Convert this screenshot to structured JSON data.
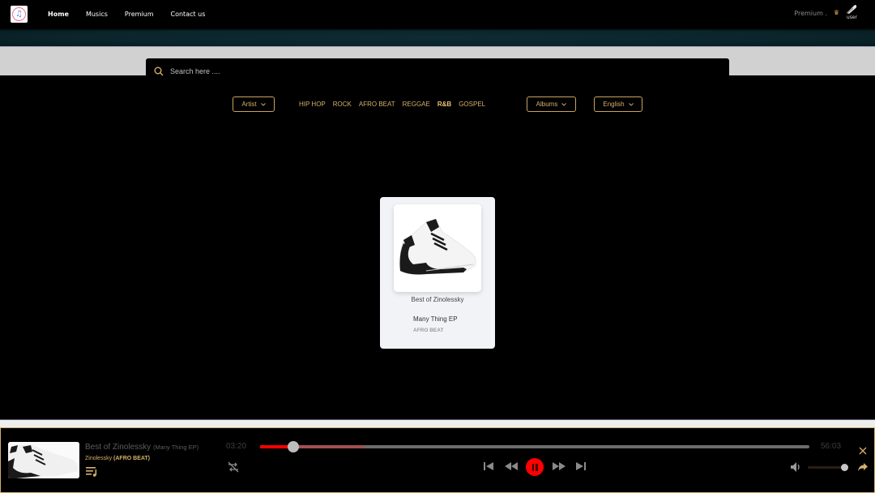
{
  "nav": {
    "logo": "music-app-logo",
    "links": [
      {
        "label": "Home",
        "active": true
      },
      {
        "label": "Musics",
        "active": false
      },
      {
        "label": "Premium",
        "active": false
      },
      {
        "label": "Contact us",
        "active": false
      }
    ],
    "premium_label": "Premium",
    "premium_separator": ".",
    "crown_icon": "crown-icon",
    "user_label": "user"
  },
  "search": {
    "placeholder": "Search here ....",
    "value": ""
  },
  "filters": {
    "artist_dropdown": "Artist",
    "genres": [
      {
        "label": "HIP HOP",
        "active": false
      },
      {
        "label": "ROCK",
        "active": false
      },
      {
        "label": "AFRO BEAT",
        "active": false
      },
      {
        "label": "REGGAE",
        "active": false
      },
      {
        "label": "R&B",
        "active": true
      },
      {
        "label": "GOSPEL",
        "active": false
      }
    ],
    "albums_dropdown": "Albums",
    "language_dropdown": "English"
  },
  "results": [
    {
      "title": "Best of Zinolessky",
      "album": "Many Thing EP",
      "genre": "AFRO BEAT",
      "artwork": "sneaker-image"
    }
  ],
  "player": {
    "track_title": "Best of Zinolessky",
    "album": "(Many Thing EP)",
    "artist": "Zinolessky",
    "genre": "(AFRO BEAT)",
    "current_time": "03:20",
    "total_time": "56:03",
    "progress_fraction": 0.06,
    "buffered_fraction": 0.19,
    "volume_fraction": 1.0,
    "state": "playing",
    "colors": {
      "accent": "#d4b06a",
      "progress": "#ff0000",
      "play_button": "#ff0000"
    }
  }
}
